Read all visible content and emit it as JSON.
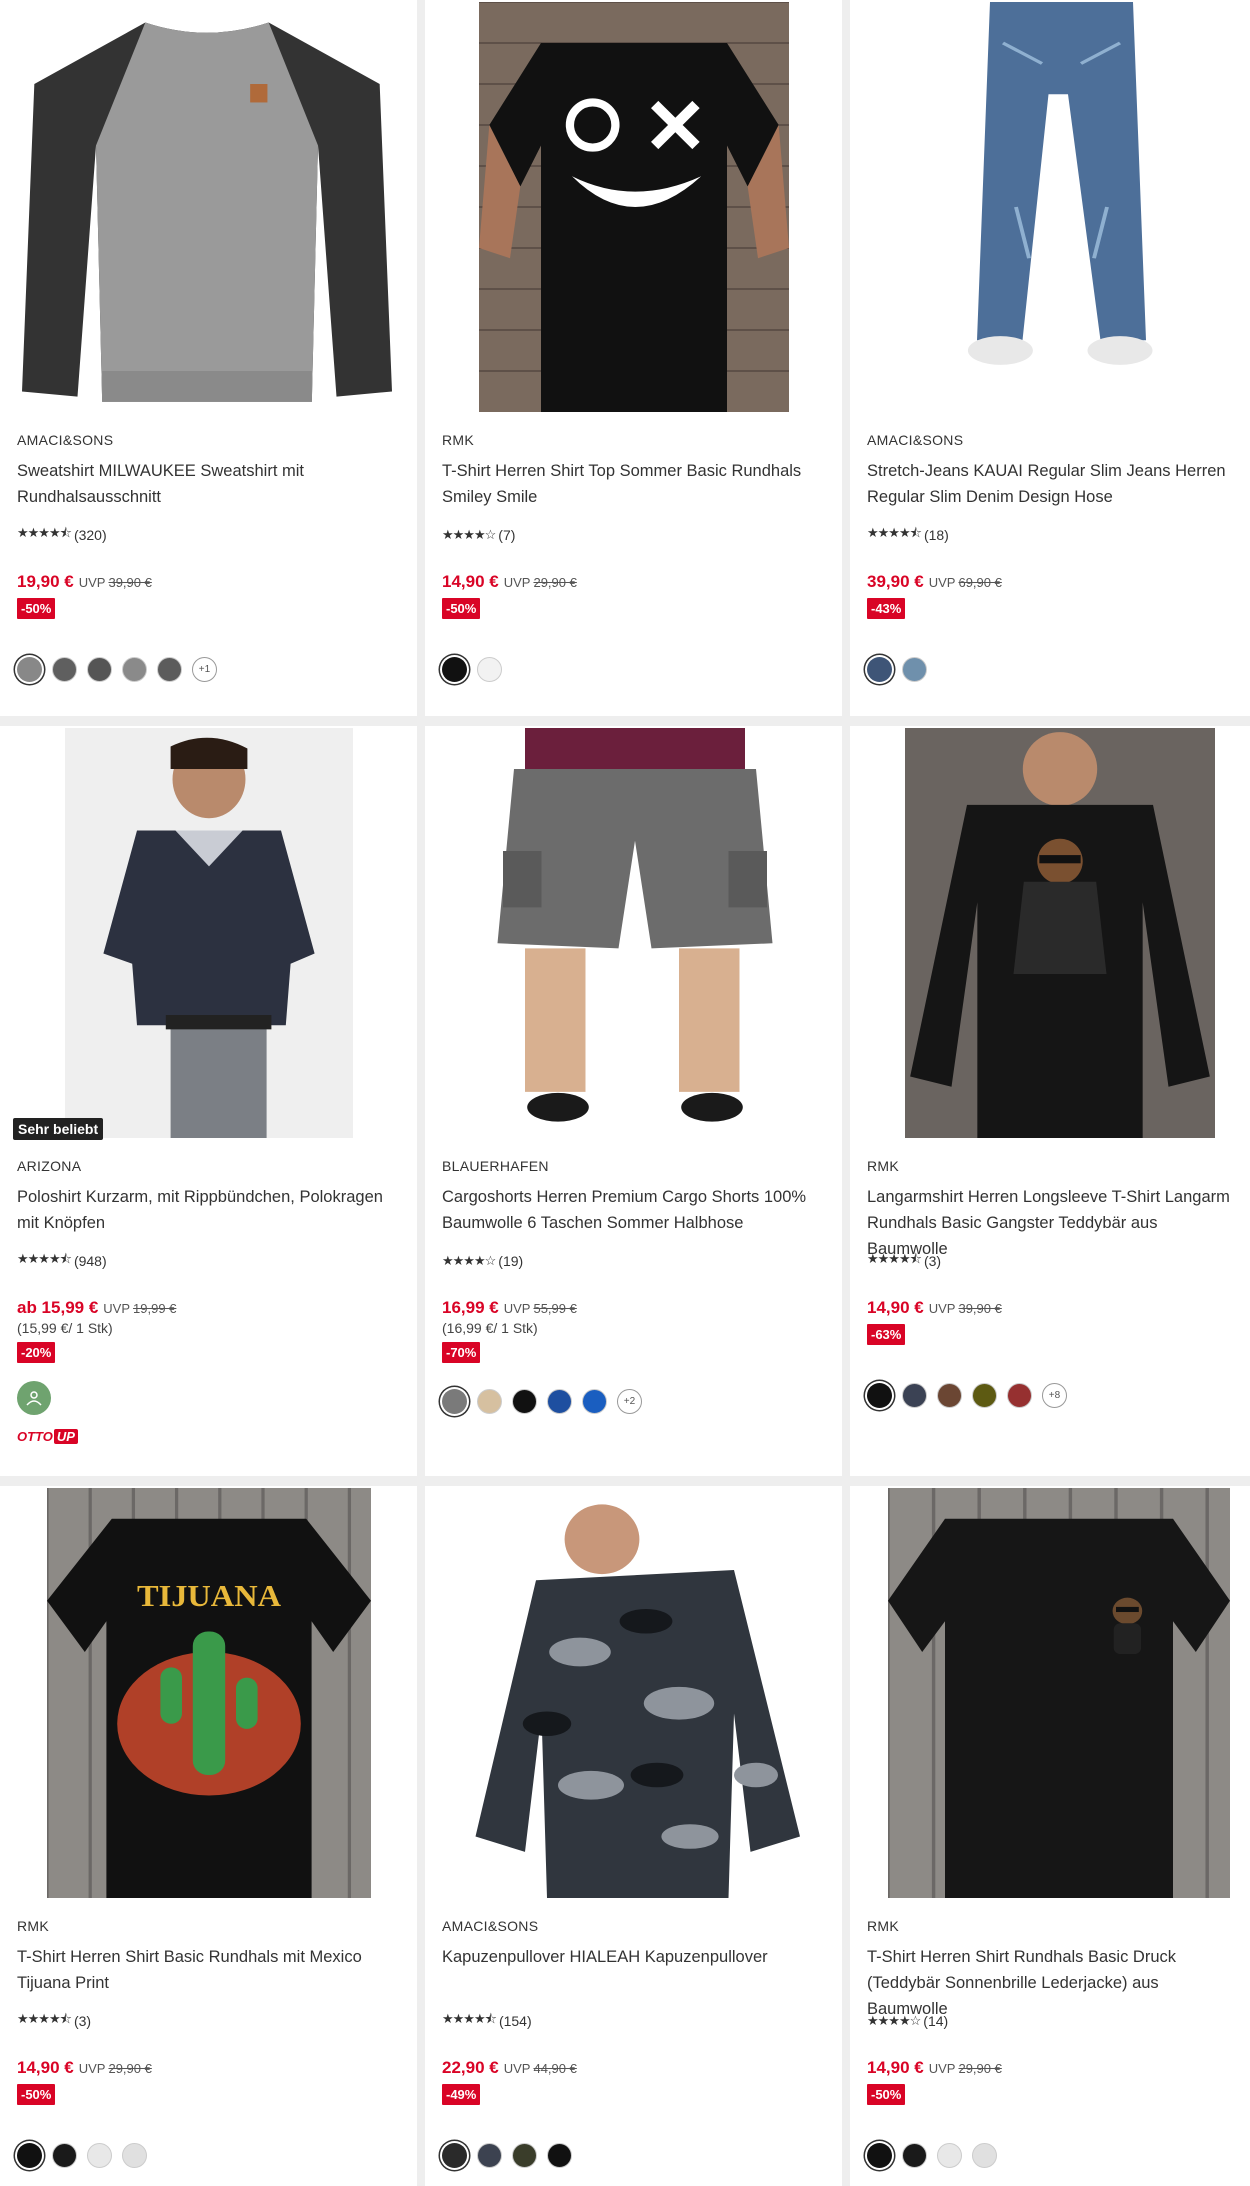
{
  "products": [
    {
      "brand": "AMACI&SONS",
      "title": "Sweatshirt MILWAUKEE Sweatshirt mit Rundhalsausschnitt",
      "stars": "★★★★⯪",
      "reviews": "(320)",
      "price": "19,90 €",
      "uvp_label": "UVP",
      "uvp": "39,90 €",
      "discount": "-50%",
      "swatches": [
        "#888888",
        "#5f5f5f",
        "#555555",
        "#8a8a8a",
        "#5c5c5c"
      ],
      "more": "+1",
      "image": "grey-raglan-sweatshirt"
    },
    {
      "brand": "RMK",
      "title": "T-Shirt Herren Shirt Top Sommer Basic Rundhals Smiley Smile",
      "stars": "★★★★☆",
      "reviews": "(7)",
      "price": "14,90 €",
      "uvp_label": "UVP",
      "uvp": "29,90 €",
      "discount": "-50%",
      "swatches": [
        "#111111",
        "#f2f2f2"
      ],
      "image": "black-smiley-tshirt"
    },
    {
      "brand": "AMACI&SONS",
      "title": "Stretch-Jeans KAUAI Regular Slim Jeans Herren Regular Slim Denim Design Hose",
      "stars": "★★★★⯪",
      "reviews": "(18)",
      "price": "39,90 €",
      "uvp_label": "UVP",
      "uvp": "69,90 €",
      "discount": "-43%",
      "swatches": [
        "#3e5577",
        "#6f90ac"
      ],
      "image": "blue-jeans"
    },
    {
      "brand": "ARIZONA",
      "title": "Poloshirt Kurzarm, mit Rippbündchen, Polokragen mit Knöpfen",
      "stars": "★★★★⯪",
      "reviews": "(948)",
      "price": "ab 15,99 €",
      "uvp_label": "UVP",
      "uvp": "19,99 €",
      "unit_price": "(15,99 €/ 1 Stk)",
      "discount": "-20%",
      "badge": "Sehr beliebt",
      "otto_up": {
        "otto": "OTTO",
        "up": "UP"
      },
      "image": "navy-poloshirt"
    },
    {
      "brand": "BLAUERHAFEN",
      "title": "Cargoshorts Herren Premium Cargo Shorts 100% Baumwolle 6 Taschen Sommer Halbhose",
      "stars": "★★★★☆",
      "reviews": "(19)",
      "price": "16,99 €",
      "uvp_label": "UVP",
      "uvp": "55,99 €",
      "unit_price": "(16,99 €/ 1 Stk)",
      "discount": "-70%",
      "swatches": [
        "#7a7a7a",
        "#d6c0a0",
        "#111111",
        "#1e4fa0",
        "#1a5ec0"
      ],
      "more": "+2",
      "image": "grey-cargo-shorts"
    },
    {
      "brand": "RMK",
      "title": "Langarmshirt Herren Longsleeve T-Shirt Langarm Rundhals Basic Gangster Teddybär aus Baumwolle",
      "stars": "★★★★⯪",
      "reviews": "(3)",
      "price": "14,90 €",
      "uvp_label": "UVP",
      "uvp": "39,90 €",
      "discount": "-63%",
      "swatches": [
        "#111111",
        "#3b4254",
        "#6b4633",
        "#5d5a12",
        "#963030"
      ],
      "more": "+8",
      "image": "black-longsleeve-teddy"
    },
    {
      "brand": "RMK",
      "title": "T-Shirt Herren Shirt Basic Rundhals mit Mexico Tijuana Print",
      "stars": "★★★★⯪",
      "reviews": "(3)",
      "price": "14,90 €",
      "uvp_label": "UVP",
      "uvp": "29,90 €",
      "discount": "-50%",
      "swatches": [
        "#111111",
        "#1a1a1a",
        "#e8e8e8",
        "#e0e0e0"
      ],
      "image": "black-tijuana-tshirt"
    },
    {
      "brand": "AMACI&SONS",
      "title": "Kapuzenpullover HIALEAH Kapuzenpullover",
      "stars": "★★★★⯪",
      "reviews": "(154)",
      "price": "22,90 €",
      "uvp_label": "UVP",
      "uvp": "44,90 €",
      "discount": "-49%",
      "swatches": [
        "#2a2a2a",
        "#3c4250",
        "#3a3d2a",
        "#111111"
      ],
      "image": "camo-hoodie"
    },
    {
      "brand": "RMK",
      "title": "T-Shirt Herren Shirt Rundhals Basic Druck (Teddybär Sonnenbrille Lederjacke) aus Baumwolle",
      "stars": "★★★★☆",
      "reviews": "(14)",
      "price": "14,90 €",
      "uvp_label": "UVP",
      "uvp": "29,90 €",
      "discount": "-50%",
      "swatches": [
        "#111111",
        "#1a1a1a",
        "#e8e8e8",
        "#e0e0e0"
      ],
      "image": "black-teddy-tshirt"
    }
  ]
}
